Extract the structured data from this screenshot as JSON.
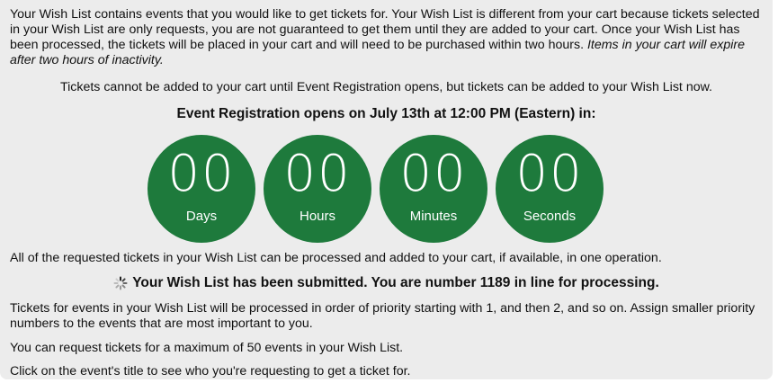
{
  "intro": {
    "text": "Your Wish List contains events that you would like to get tickets for. Your Wish List is different from your cart because tickets selected in your Wish List are only requests, you are not guaranteed to get them until they are added to your cart. Once your Wish List has been processed, the tickets will be placed in your cart and will need to be purchased within two hours.",
    "italic": "Items in your cart will expire after two hours of inactivity."
  },
  "notice": "Tickets cannot be added to your cart until Event Registration opens, but tickets can be added to your Wish List now.",
  "opens_heading": "Event Registration opens on July 13th at 12:00 PM (Eastern) in:",
  "countdown": {
    "days": {
      "value": "00",
      "label": "Days"
    },
    "hours": {
      "value": "00",
      "label": "Hours"
    },
    "minutes": {
      "value": "00",
      "label": "Minutes"
    },
    "seconds": {
      "value": "00",
      "label": "Seconds"
    },
    "color": "#1e7a3c"
  },
  "all_requested": "All of the requested tickets in your Wish List can be processed and added to your cart, if available, in one operation.",
  "submitted": {
    "icon": "loading-spinner-icon",
    "text": "Your Wish List has been submitted. You are number 1189 in line for processing."
  },
  "priority_info": "Tickets for events in your Wish List will be processed in order of priority starting with 1, and then 2, and so on. Assign smaller priority numbers to the events that are most important to you.",
  "max_info": "You can request tickets for a maximum of 50 events in your Wish List.",
  "click_info": "Click on the event's title to see who you're requesting to get a ticket for."
}
